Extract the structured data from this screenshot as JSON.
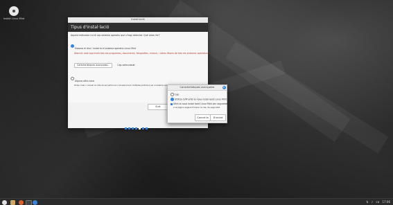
{
  "desktop": {
    "icon_label": "Install Linux Mint"
  },
  "installer": {
    "window_title": "Instal·lació",
    "page_title": "Tipus d'instal·lació",
    "question": "Aquest ordinador no té cap sistema operatiu que s'hagi detectat. Què voleu fer?",
    "option1_label": "Esborra el disc i instal·la el sistema operatiu Linux Mint",
    "option1_warning": "Atenció: això suprimirà tots els programes, documents, fotografies, música, i altres fitxers de tots els sistemes operatius.",
    "advanced_features_button": "Característiques avançades...",
    "none_selected": "Cap seleccionat",
    "option2_label": "Alguna altra cosa",
    "option2_desc": "Podeu crear o canviar la mida de les particions o bé seleccionar múltiples particions per al sistema operatiu Linux Mint.",
    "quit_button": "Surt"
  },
  "progress": {
    "total_steps": 7,
    "active_step": 5
  },
  "dialog": {
    "title": "Característiques avançades",
    "none_label": "Cap",
    "lvm_label": "Utilitza LVM amb la nova instal·lació Linux Mint",
    "encrypt_label": "Xifra la nova instal·lació Linux Mint per seguretat",
    "encrypt_sublabel": "A la pàgina següent triareu la clau de seguretat.",
    "cancel_button": "Cancel·la",
    "ok_button": "D'acord",
    "accent": "#3584e4"
  },
  "taskbar": {
    "clock": "17:06",
    "tray_keyboard": "ca",
    "tray_network_icon": "network-icon",
    "tray_sound_icon": "speaker-icon"
  }
}
